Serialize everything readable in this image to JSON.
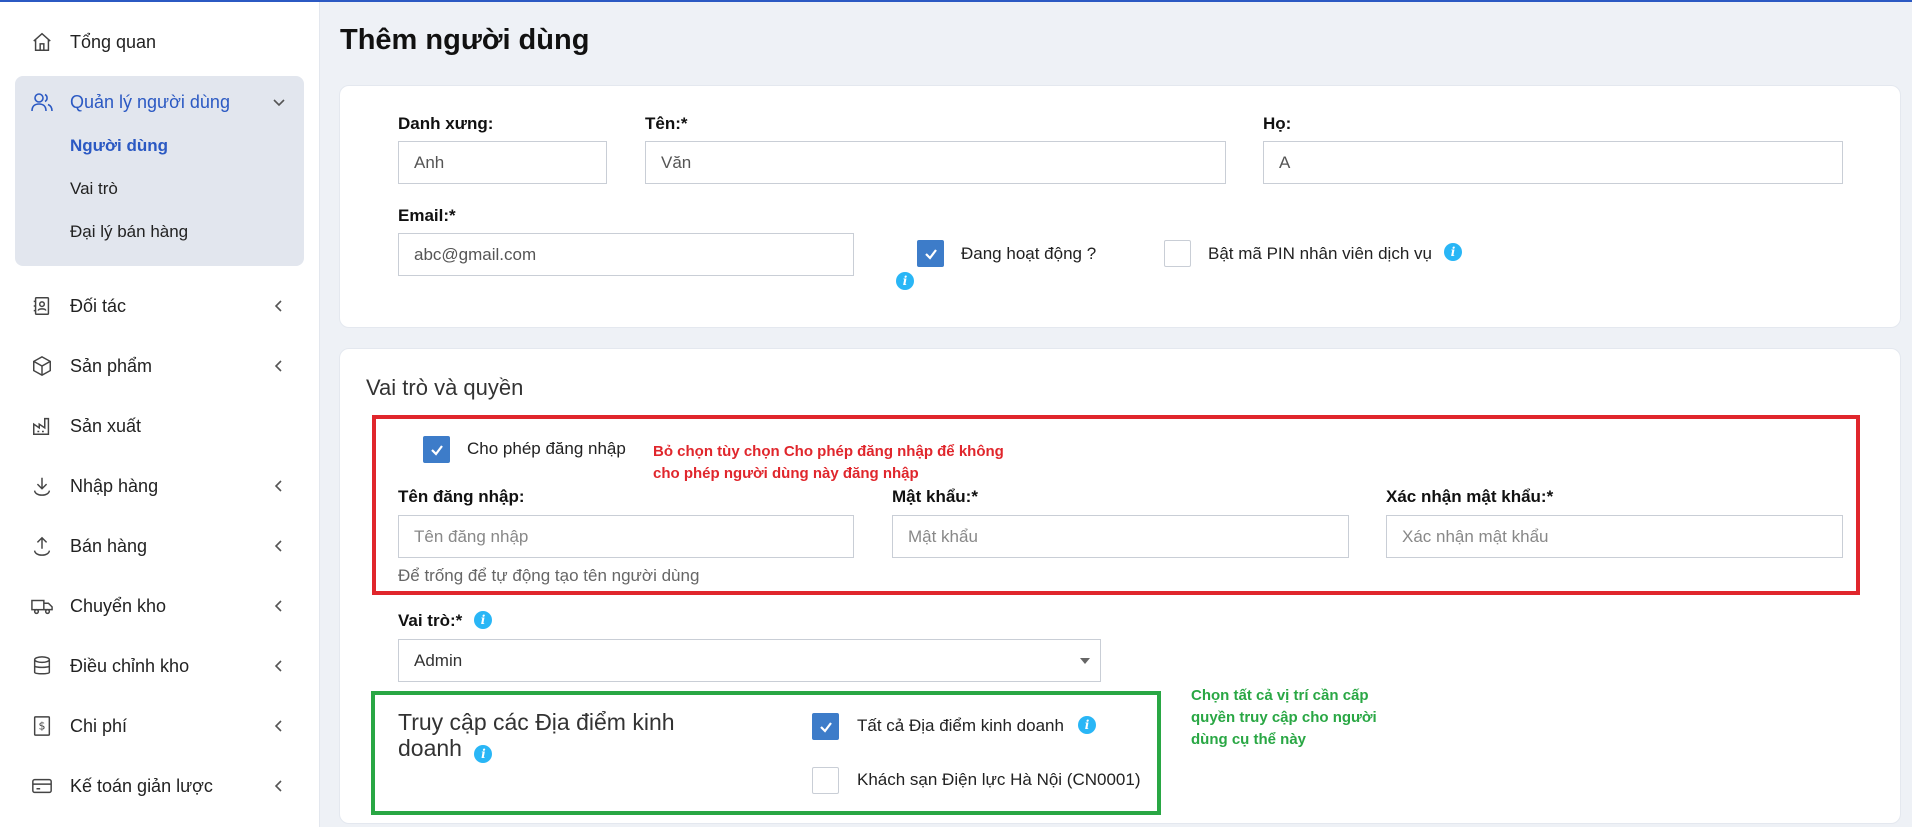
{
  "sidebar": {
    "items": [
      {
        "label": "Tổng quan",
        "icon": "home-icon"
      },
      {
        "label": "Quản lý người dùng",
        "icon": "users-icon"
      },
      {
        "label": "Đối tác",
        "icon": "contacts-icon"
      },
      {
        "label": "Sản phẩm",
        "icon": "box-icon"
      },
      {
        "label": "Sản xuất",
        "icon": "factory-icon"
      },
      {
        "label": "Nhập hàng",
        "icon": "download-icon"
      },
      {
        "label": "Bán hàng",
        "icon": "upload-icon"
      },
      {
        "label": "Chuyển kho",
        "icon": "truck-icon"
      },
      {
        "label": "Điều chỉnh kho",
        "icon": "database-icon"
      },
      {
        "label": "Chi phí",
        "icon": "dollar-icon"
      },
      {
        "label": "Kế toán giản lược",
        "icon": "card-icon"
      }
    ],
    "subitems": [
      "Người dùng",
      "Vai trò",
      "Đại lý bán hàng"
    ]
  },
  "page": {
    "title": "Thêm người dùng"
  },
  "form": {
    "salutation_label": "Danh xưng:",
    "salutation_value": "Anh",
    "first_name_label": "Tên:*",
    "first_name_value": "Văn",
    "last_name_label": "Họ:",
    "last_name_value": "A",
    "email_label": "Email:*",
    "email_value": "abc@gmail.com",
    "active_label": "Đang hoạt động ?",
    "pin_label": "Bật mã PIN nhân viên dịch vụ"
  },
  "roles": {
    "section_title": "Vai trò và quyền",
    "allow_login_label": "Cho phép đăng nhập",
    "annotation_red": "Bỏ chọn tùy chọn Cho phép đăng nhập để không cho phép người dùng này đăng nhập",
    "username_label": "Tên đăng nhập:",
    "username_placeholder": "Tên đăng nhập",
    "password_label": "Mật khẩu:*",
    "password_placeholder": "Mật khẩu",
    "confirm_label": "Xác nhận mật khẩu:*",
    "confirm_placeholder": "Xác nhận mật khẩu",
    "username_hint": "Để trống để tự động tạo tên người dùng",
    "role_label": "Vai trò:*",
    "role_value": "Admin",
    "locations_title": "Truy cập các Địa điểm kinh doanh",
    "all_locations_label": "Tất cả Địa điểm kinh doanh",
    "location_1_label": "Khách sạn Điện lực Hà Nội (CN0001)",
    "annotation_green": "Chọn tất cả vị trí cần cấp quyền truy cập cho người dùng cụ thể này"
  },
  "colors": {
    "accent": "#2b59c3",
    "checkbox": "#3d7cc9",
    "info": "#29b6f6",
    "red": "#e0262c",
    "green": "#29a744"
  }
}
